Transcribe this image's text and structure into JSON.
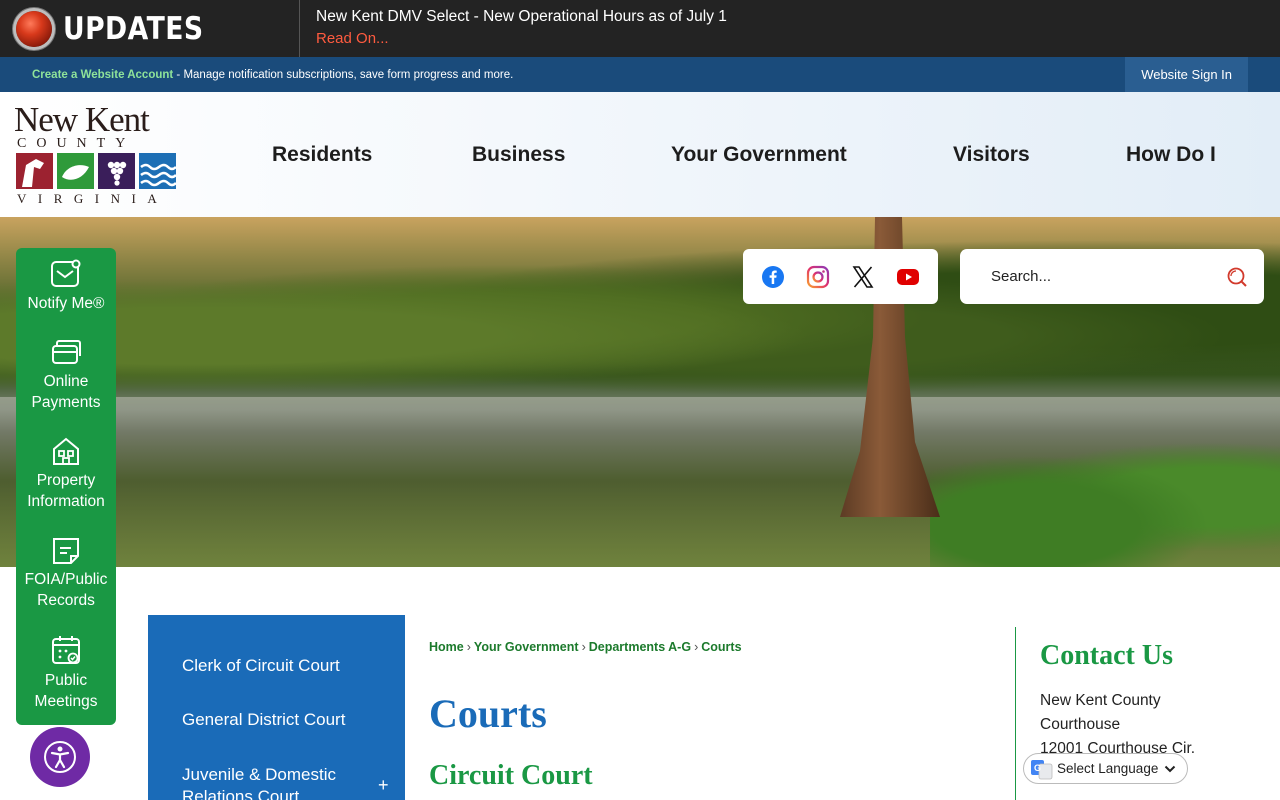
{
  "alert": {
    "title": "UPDATES",
    "message": "New Kent DMV Select - New Operational Hours as of July 1",
    "link": "Read On..."
  },
  "account": {
    "create_link": "Create a Website Account",
    "description": " - Manage notification subscriptions, save form progress and more.",
    "sign_in": "Website Sign In"
  },
  "logo": {
    "name": "New Kent",
    "county": "COUNTY",
    "state": "VIRGINIA"
  },
  "nav": [
    "Residents",
    "Business",
    "Your Government",
    "Visitors",
    "How Do I"
  ],
  "social": [
    "facebook-icon",
    "instagram-icon",
    "x-icon",
    "youtube-icon"
  ],
  "search": {
    "placeholder": "Search..."
  },
  "quick_links": [
    {
      "label": "Notify Me®",
      "icon": "notify-icon"
    },
    {
      "label": "Online Payments",
      "icon": "payments-icon"
    },
    {
      "label": "Property Information",
      "icon": "property-icon"
    },
    {
      "label": "FOIA/Public Records",
      "icon": "records-icon"
    },
    {
      "label": "Public Meetings",
      "icon": "calendar-icon"
    }
  ],
  "side_nav": [
    "Clerk of Circuit Court",
    "General District Court",
    "Juvenile & Domestic Relations Court"
  ],
  "breadcrumb": [
    "Home",
    "Your Government",
    "Departments A-G",
    "Courts"
  ],
  "main": {
    "title": "Courts",
    "subheading": "Circuit Court"
  },
  "contact": {
    "title": "Contact Us",
    "line1": "New Kent County",
    "line2": "Courthouse",
    "line3": "12001 Courthouse Cir."
  },
  "translate": {
    "label": "Select Language"
  },
  "colors": {
    "alert_bg": "#232323",
    "account_bar": "#1a4b7b",
    "green": "#1a9844",
    "blue": "#1a6bb8",
    "alert_link": "#ff5b3f"
  }
}
